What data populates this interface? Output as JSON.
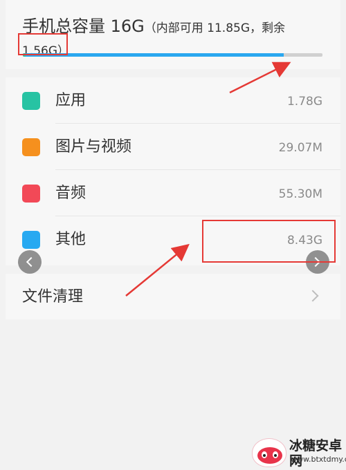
{
  "storage": {
    "title_prefix": "手机总容量 16G",
    "title_detail": "（内部可用 11.85G，剩余",
    "remaining": "1.56G",
    "close_paren": "）",
    "used_fraction": 0.87,
    "bar_color": "#2aa7ef"
  },
  "categories": [
    {
      "label": "应用",
      "size": "1.78G",
      "color": "#27c3a3"
    },
    {
      "label": "图片与视频",
      "size": "29.07M",
      "color": "#f5901e"
    },
    {
      "label": "音频",
      "size": "55.30M",
      "color": "#f24957"
    },
    {
      "label": "其他",
      "size": "8.43G",
      "color": "#27a9f1"
    }
  ],
  "cleanup": {
    "label": "文件清理"
  },
  "watermark": {
    "text": "冰糖安卓网",
    "url": "www.btxtdmy.com"
  },
  "colors": {
    "annotation": "#e53935"
  }
}
